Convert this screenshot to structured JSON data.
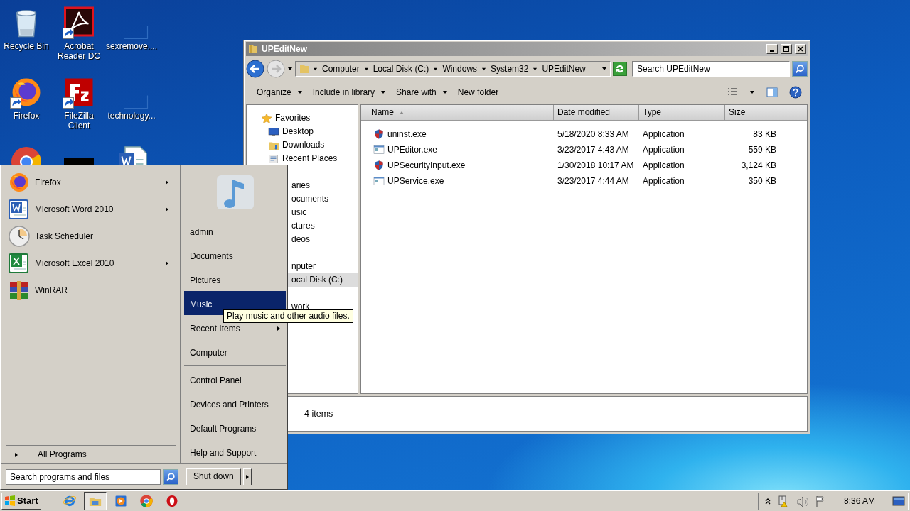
{
  "desktop_icons": [
    {
      "label": "Recycle Bin",
      "kind": "recycle",
      "shortcut": false
    },
    {
      "label": "Acrobat Reader DC",
      "kind": "acrobat",
      "shortcut": true
    },
    {
      "label": "sexremove....",
      "kind": "blank"
    },
    {
      "label": "Firefox",
      "kind": "firefox",
      "shortcut": true
    },
    {
      "label": "FileZilla Client",
      "kind": "filezilla",
      "shortcut": true
    },
    {
      "label": "technology...",
      "kind": "blank"
    },
    {
      "kind": "chrome"
    },
    {
      "kind": "dark"
    },
    {
      "kind": "worddoc"
    }
  ],
  "explorer": {
    "title": "UPEditNew",
    "breadcrumb": [
      "Computer",
      "Local Disk (C:)",
      "Windows",
      "System32",
      "UPEditNew"
    ],
    "search": {
      "placeholder": "Search UPEditNew"
    },
    "toolbar": [
      {
        "label": "Organize",
        "dropdown": true
      },
      {
        "label": "Include in library",
        "dropdown": true
      },
      {
        "label": "Share with",
        "dropdown": true
      },
      {
        "label": "New folder",
        "dropdown": false
      }
    ],
    "nav": [
      {
        "label": "Favorites",
        "kind": "favorites",
        "selected": false,
        "children": [
          {
            "label": "Desktop",
            "kind": "desktop",
            "selected": false
          },
          {
            "label": "Downloads",
            "kind": "downloads",
            "selected": false
          },
          {
            "label": "Recent Places",
            "kind": "recent",
            "selected": false
          }
        ]
      },
      {
        "label": "aries",
        "kind": "partial",
        "selected": false,
        "children": [
          {
            "label": "ocuments",
            "kind": "partial",
            "selected": false
          },
          {
            "label": "usic",
            "kind": "partial",
            "selected": false
          },
          {
            "label": "ctures",
            "kind": "partial",
            "selected": false
          },
          {
            "label": "deos",
            "kind": "partial",
            "selected": false
          }
        ]
      },
      {
        "label": "nputer",
        "kind": "partial",
        "selected": false,
        "children": [
          {
            "label": "ocal Disk (C:)",
            "kind": "partial",
            "selected": true
          }
        ]
      },
      {
        "label": "work",
        "kind": "partial",
        "selected": false
      }
    ],
    "columns": [
      {
        "label": "Name",
        "sorted": true
      },
      {
        "label": "Date modified",
        "sorted": false
      },
      {
        "label": "Type",
        "sorted": false
      },
      {
        "label": "Size",
        "sorted": false
      }
    ],
    "files": [
      {
        "name": "uninst.exe",
        "date": "5/18/2020 8:33 AM",
        "type": "Application",
        "size": "83 KB",
        "kind": "shield"
      },
      {
        "name": "UPEditor.exe",
        "date": "3/23/2017 4:43 AM",
        "type": "Application",
        "size": "559 KB",
        "kind": "app"
      },
      {
        "name": "UPSecurityInput.exe",
        "date": "1/30/2018 10:17 AM",
        "type": "Application",
        "size": "3,124 KB",
        "kind": "shield"
      },
      {
        "name": "UPService.exe",
        "date": "3/23/2017 4:44 AM",
        "type": "Application",
        "size": "350 KB",
        "kind": "app"
      }
    ],
    "status": "4 items"
  },
  "start_menu": {
    "programs": [
      {
        "label": "Firefox",
        "kind": "firefox",
        "submenu": true
      },
      {
        "label": "Microsoft Word 2010",
        "kind": "word",
        "submenu": true
      },
      {
        "label": "Task Scheduler",
        "kind": "clock",
        "submenu": false
      },
      {
        "label": "Microsoft Excel 2010",
        "kind": "excel",
        "submenu": true
      },
      {
        "label": "WinRAR",
        "kind": "winrar",
        "submenu": false
      }
    ],
    "all_programs": "All Programs",
    "search": {
      "placeholder": "Search programs and files"
    },
    "places": [
      {
        "label": "admin",
        "selected": false,
        "submenu": false,
        "separator_before": false
      },
      {
        "label": "Documents",
        "selected": false,
        "submenu": false,
        "separator_before": false
      },
      {
        "label": "Pictures",
        "selected": false,
        "submenu": false,
        "separator_before": false
      },
      {
        "label": "Music",
        "selected": true,
        "submenu": false,
        "separator_before": false
      },
      {
        "label": "Recent Items",
        "selected": false,
        "submenu": true,
        "separator_before": false
      },
      {
        "label": "Computer",
        "selected": false,
        "submenu": false,
        "separator_before": false
      },
      {
        "label": "Control Panel",
        "selected": false,
        "submenu": false,
        "separator_before": true
      },
      {
        "label": "Devices and Printers",
        "selected": false,
        "submenu": false,
        "separator_before": false
      },
      {
        "label": "Default Programs",
        "selected": false,
        "submenu": false,
        "separator_before": false
      },
      {
        "label": "Help and Support",
        "selected": false,
        "submenu": false,
        "separator_before": false
      }
    ],
    "shutdown": "Shut down",
    "tooltip": "Play music and other audio files."
  },
  "taskbar": {
    "start": "Start",
    "apps": [
      {
        "kind": "ie",
        "selected": false
      },
      {
        "kind": "folder",
        "selected": true
      },
      {
        "kind": "media",
        "selected": false
      },
      {
        "kind": "chrome",
        "selected": false
      },
      {
        "kind": "opera",
        "selected": false
      }
    ],
    "clock": "8:36 AM"
  }
}
